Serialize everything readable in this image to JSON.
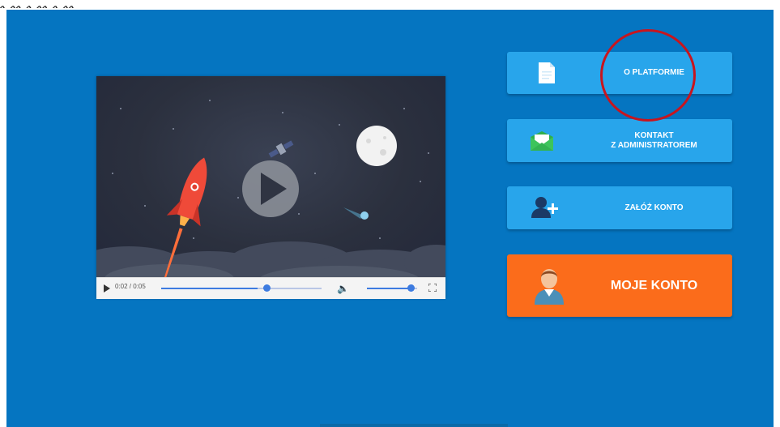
{
  "video": {
    "time": "0:02 / 0:05",
    "progress": 0.6,
    "volume": 0.9
  },
  "buttons": {
    "about": "O PLATFORMIE",
    "contact": "KONTAKT\nZ ADMINISTRATOREM",
    "register": "ZAŁÓŻ KONTO",
    "account": "MOJE KONTO"
  },
  "colors": {
    "background": "#0575c1",
    "button_blue": "#28a5eb",
    "button_orange": "#fb6c1b",
    "highlight": "#c8151e"
  },
  "icons": {
    "about": "document-icon",
    "contact": "envelope-icon",
    "register": "add-user-icon",
    "account": "user-avatar-icon",
    "play": "play-icon",
    "volume": "volume-icon",
    "fullscreen": "fullscreen-icon"
  }
}
